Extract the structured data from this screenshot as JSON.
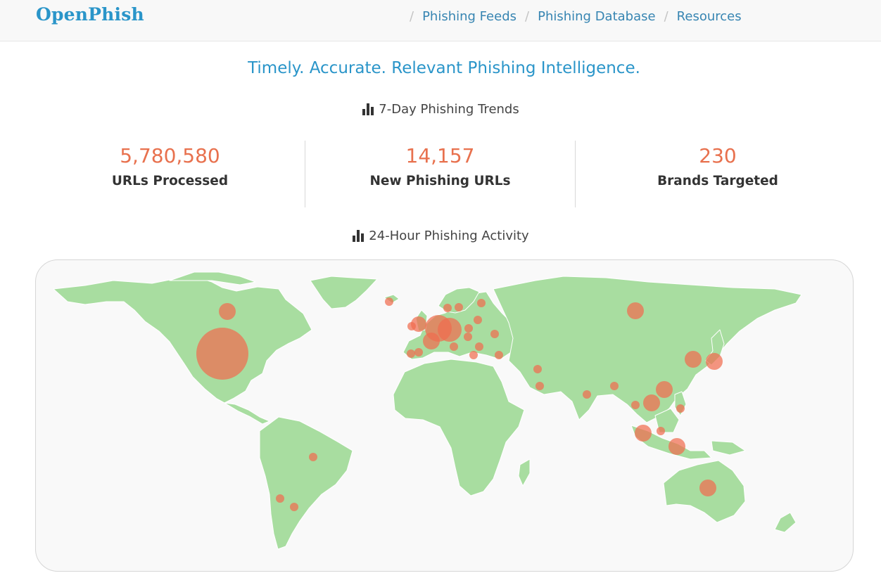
{
  "header": {
    "brand": "OpenPhish",
    "nav": [
      {
        "label": "Phishing Feeds"
      },
      {
        "label": "Phishing Database"
      },
      {
        "label": "Resources"
      }
    ],
    "separator": "/"
  },
  "tagline": "Timely. Accurate. Relevant Phishing Intelligence.",
  "trends": {
    "title": "7-Day Phishing Trends",
    "icon": "bar-chart-icon",
    "stats": [
      {
        "value": "5,780,580",
        "label": "URLs Processed"
      },
      {
        "value": "14,157",
        "label": "New Phishing URLs"
      },
      {
        "value": "230",
        "label": "Brands Targeted"
      }
    ]
  },
  "activity": {
    "title": "24-Hour Phishing Activity",
    "icon": "bar-chart-icon",
    "land_color": "#a8dda0",
    "bubble_color": "#f06c4f",
    "hotspots": [
      {
        "region": "United States",
        "size": "very-large"
      },
      {
        "region": "Canada",
        "size": "medium"
      },
      {
        "region": "Iceland",
        "size": "small"
      },
      {
        "region": "Ireland",
        "size": "small"
      },
      {
        "region": "United Kingdom",
        "size": "medium"
      },
      {
        "region": "Netherlands",
        "size": "large"
      },
      {
        "region": "Germany",
        "size": "large"
      },
      {
        "region": "France",
        "size": "medium"
      },
      {
        "region": "Spain",
        "size": "small"
      },
      {
        "region": "Portugal",
        "size": "small"
      },
      {
        "region": "Italy",
        "size": "small"
      },
      {
        "region": "Switzerland",
        "size": "small"
      },
      {
        "region": "Norway",
        "size": "small"
      },
      {
        "region": "Sweden",
        "size": "small"
      },
      {
        "region": "Finland",
        "size": "small"
      },
      {
        "region": "Lithuania",
        "size": "small"
      },
      {
        "region": "Poland",
        "size": "small"
      },
      {
        "region": "Ukraine",
        "size": "small"
      },
      {
        "region": "Romania",
        "size": "small"
      },
      {
        "region": "Bulgaria",
        "size": "small"
      },
      {
        "region": "Greece",
        "size": "small"
      },
      {
        "region": "Turkey",
        "size": "small"
      },
      {
        "region": "Russia",
        "size": "medium"
      },
      {
        "region": "Iran",
        "size": "small"
      },
      {
        "region": "United Arab Emirates",
        "size": "small"
      },
      {
        "region": "India",
        "size": "small"
      },
      {
        "region": "Bangladesh",
        "size": "small"
      },
      {
        "region": "Thailand",
        "size": "small"
      },
      {
        "region": "Vietnam",
        "size": "medium"
      },
      {
        "region": "Hong Kong",
        "size": "medium"
      },
      {
        "region": "Philippines",
        "size": "small"
      },
      {
        "region": "South Korea",
        "size": "medium"
      },
      {
        "region": "Japan",
        "size": "medium"
      },
      {
        "region": "Singapore",
        "size": "medium"
      },
      {
        "region": "Malaysia",
        "size": "small"
      },
      {
        "region": "Indonesia",
        "size": "medium"
      },
      {
        "region": "Australia",
        "size": "medium"
      },
      {
        "region": "Brazil",
        "size": "small"
      },
      {
        "region": "Chile",
        "size": "small"
      },
      {
        "region": "Argentina",
        "size": "small"
      }
    ]
  }
}
